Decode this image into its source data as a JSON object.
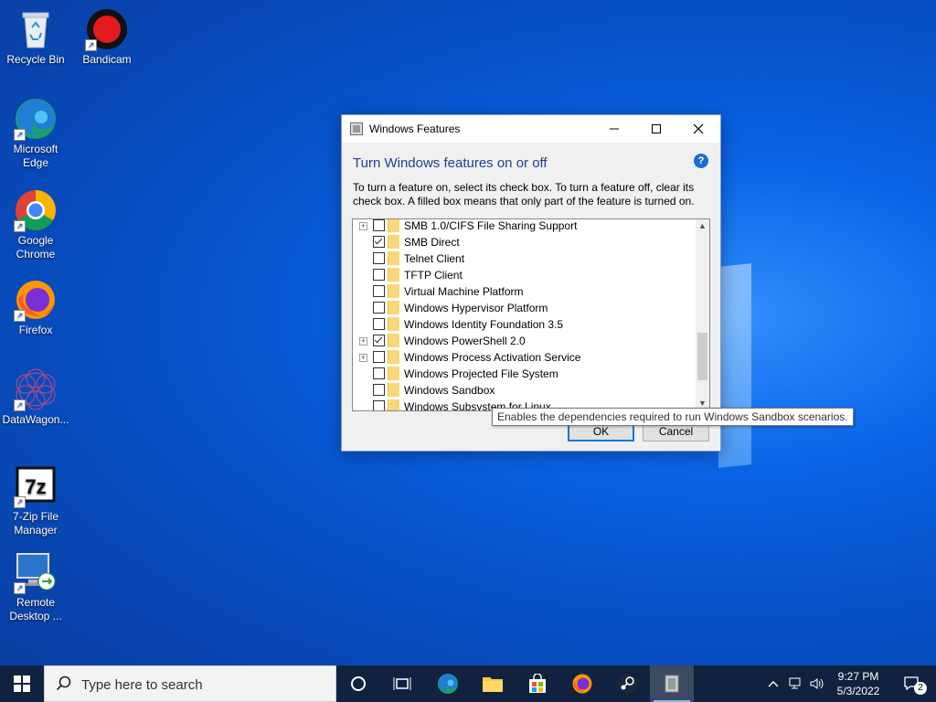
{
  "desktop": {
    "icons": [
      {
        "label": "Recycle Bin"
      },
      {
        "label": "Bandicam"
      },
      {
        "label": "Microsoft Edge"
      },
      {
        "label": "Google Chrome"
      },
      {
        "label": "Firefox"
      },
      {
        "label": "DataWagon..."
      },
      {
        "label": "7-Zip File Manager"
      },
      {
        "label": "Remote Desktop ..."
      }
    ]
  },
  "dialog": {
    "title": "Windows Features",
    "heading": "Turn Windows features on or off",
    "help_glyph": "?",
    "description": "To turn a feature on, select its check box. To turn a feature off, clear its check box. A filled box means that only part of the feature is turned on.",
    "features": [
      {
        "label": "SMB 1.0/CIFS File Sharing Support",
        "checked": false,
        "expandable": true
      },
      {
        "label": "SMB Direct",
        "checked": true,
        "expandable": false
      },
      {
        "label": "Telnet Client",
        "checked": false,
        "expandable": false
      },
      {
        "label": "TFTP Client",
        "checked": false,
        "expandable": false
      },
      {
        "label": "Virtual Machine Platform",
        "checked": false,
        "expandable": false
      },
      {
        "label": "Windows Hypervisor Platform",
        "checked": false,
        "expandable": false
      },
      {
        "label": "Windows Identity Foundation 3.5",
        "checked": false,
        "expandable": false
      },
      {
        "label": "Windows PowerShell 2.0",
        "checked": true,
        "expandable": true
      },
      {
        "label": "Windows Process Activation Service",
        "checked": false,
        "expandable": true
      },
      {
        "label": "Windows Projected File System",
        "checked": false,
        "expandable": false
      },
      {
        "label": "Windows Sandbox",
        "checked": false,
        "expandable": false
      },
      {
        "label": "Windows Subsystem for Linux",
        "checked": false,
        "expandable": false
      }
    ],
    "ok_label": "OK",
    "cancel_label": "Cancel",
    "tooltip": "Enables the dependencies required to run Windows Sandbox scenarios."
  },
  "taskbar": {
    "search_placeholder": "Type here to search",
    "time": "9:27 PM",
    "date": "5/3/2022",
    "notification_count": "2"
  },
  "colors": {
    "heading": "#1f3f8f",
    "accent": "#0078d7",
    "taskbar": "#10223f"
  }
}
